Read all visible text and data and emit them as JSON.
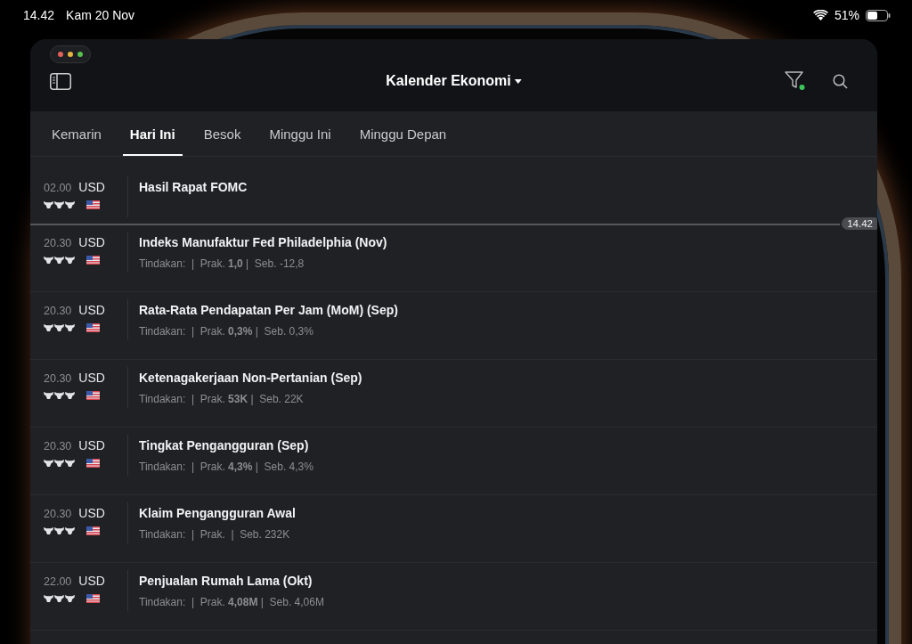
{
  "status_bar": {
    "time": "14.42",
    "date": "Kam 20 Nov",
    "battery": "51%"
  },
  "header": {
    "title": "Kalender Ekonomi",
    "filter_active": true
  },
  "tabs": [
    {
      "label": "Kemarin",
      "selected": false
    },
    {
      "label": "Hari Ini",
      "selected": true
    },
    {
      "label": "Besok",
      "selected": false
    },
    {
      "label": "Minggu Ini",
      "selected": false
    },
    {
      "label": "Minggu Depan",
      "selected": false
    }
  ],
  "now_marker": {
    "time": "14.42"
  },
  "events": [
    {
      "time": "02.00",
      "currency": "USD",
      "stars": 3,
      "title": "Hasil Rapat FOMC",
      "now_line_below": true
    },
    {
      "time": "20.30",
      "currency": "USD",
      "stars": 3,
      "title": "Indeks Manufaktur Fed Philadelphia (Nov)",
      "details": "Tindakan:  |  Prak. **1,0** |  Seb. -12,8"
    },
    {
      "time": "20.30",
      "currency": "USD",
      "stars": 3,
      "title": "Rata-Rata Pendapatan Per Jam (MoM) (Sep)",
      "details": "Tindakan:  |  Prak. **0,3%** |  Seb. 0,3%"
    },
    {
      "time": "20.30",
      "currency": "USD",
      "stars": 3,
      "title": "Ketenagakerjaan Non-Pertanian (Sep)",
      "details": "Tindakan:  |  Prak. **53K** |  Seb. 22K"
    },
    {
      "time": "20.30",
      "currency": "USD",
      "stars": 3,
      "title": "Tingkat Pengangguran (Sep)",
      "details": "Tindakan:  |  Prak. **4,3%** |  Seb. 4,3%"
    },
    {
      "time": "20.30",
      "currency": "USD",
      "stars": 3,
      "title": "Klaim Pengangguran Awal",
      "details": "Tindakan:  |  Prak.  |  Seb. 232K"
    },
    {
      "time": "22.00",
      "currency": "USD",
      "stars": 3,
      "title": "Penjualan Rumah Lama (Okt)",
      "details": "Tindakan:  |  Prak. **4,08M** |  Seb. 4,06M"
    }
  ]
}
